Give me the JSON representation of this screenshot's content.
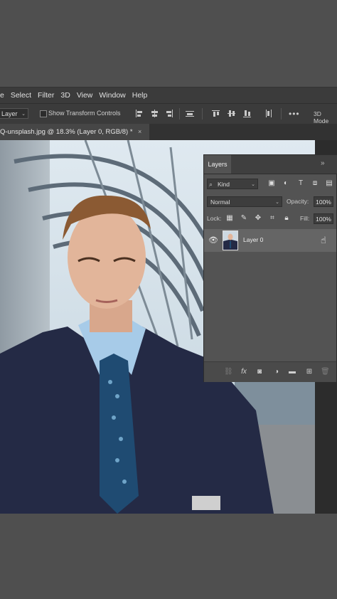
{
  "menubar": {
    "items": [
      "e",
      "Select",
      "Filter",
      "3D",
      "View",
      "Window",
      "Help"
    ]
  },
  "options": {
    "auto_select_value": "Layer",
    "transform_controls_label": "Show Transform Controls",
    "more_label": "•••",
    "mode_3d_label": "3D Mode"
  },
  "document_tab": {
    "title": "Q-unsplash.jpg @ 18.3% (Layer 0, RGB/8) *",
    "close": "×"
  },
  "layers_panel": {
    "tab_label": "Layers",
    "collapse_label": "»",
    "filter_kind": "Kind",
    "blend_mode": "Normal",
    "opacity_label": "Opacity:",
    "opacity_value": "100%",
    "lock_label": "Lock:",
    "fill_label": "Fill:",
    "fill_value": "100%",
    "layers": [
      {
        "name": "Layer 0",
        "visible": true
      }
    ]
  },
  "colors": {
    "accent_bg": "#3b3b3b",
    "panel_bg": "#535353",
    "selected_row": "#656565"
  }
}
